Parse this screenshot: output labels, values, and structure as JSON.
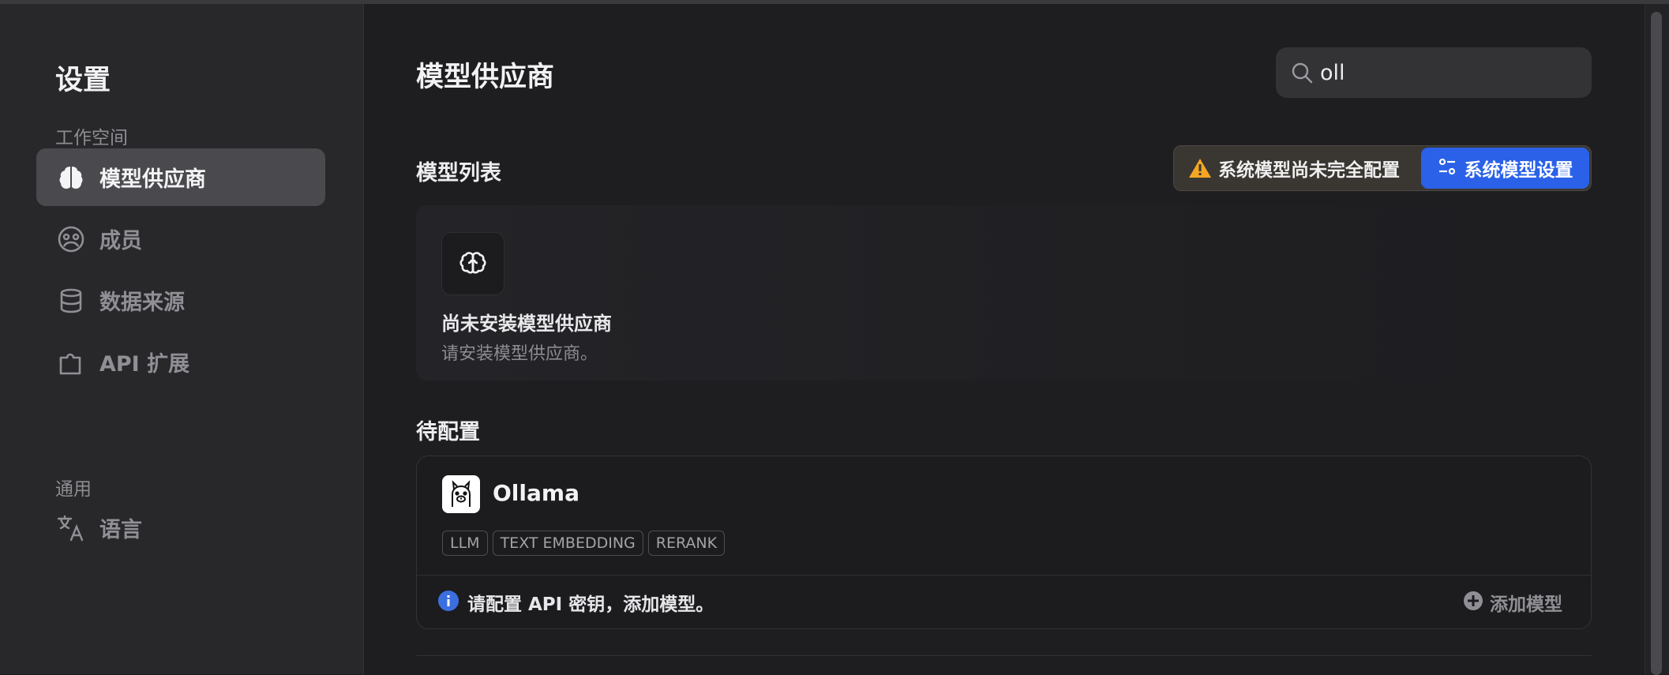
{
  "sidebar": {
    "title": "设置",
    "sections": [
      {
        "label": "工作空间"
      },
      {
        "label": "通用"
      }
    ],
    "items": [
      {
        "label": "模型供应商",
        "icon": "brain-icon",
        "active": true
      },
      {
        "label": "成员",
        "icon": "members-icon",
        "active": false
      },
      {
        "label": "数据来源",
        "icon": "database-icon",
        "active": false
      },
      {
        "label": "API 扩展",
        "icon": "puzzle-icon",
        "active": false
      },
      {
        "label": "语言",
        "icon": "translate-icon",
        "active": false
      }
    ]
  },
  "main": {
    "title": "模型供应商",
    "search": {
      "value": "oll",
      "icon": "search-icon"
    },
    "model_list": {
      "title": "模型列表",
      "warning_text": "系统模型尚未完全配置",
      "config_button": "系统模型设置",
      "empty": {
        "title": "尚未安装模型供应商",
        "description": "请安装模型供应商。"
      }
    },
    "pending": {
      "title": "待配置",
      "providers": [
        {
          "name": "Ollama",
          "tags": [
            "LLM",
            "TEXT EMBEDDING",
            "RERANK"
          ],
          "info_text": "请配置 API 密钥，添加模型。",
          "add_label": "添加模型"
        }
      ]
    }
  },
  "colors": {
    "accent": "#2a61e8",
    "warning": "#f5a623",
    "info": "#3b6fe0"
  }
}
